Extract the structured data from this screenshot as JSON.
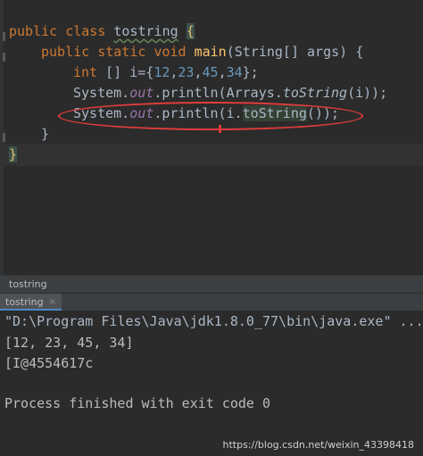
{
  "editor": {
    "lines": {
      "l1": {
        "kw1": "public",
        "kw2": "class",
        "classname": "tostring",
        "brace": "{"
      },
      "l2": {
        "kw1": "public",
        "kw2": "static",
        "kw3": "void",
        "method": "main",
        "params": "(String[] args) {"
      },
      "l3": {
        "kw": "int",
        "decl": " [] i={",
        "n1": "12",
        "n2": "23",
        "n3": "45",
        "n4": "34",
        "tail": "};"
      },
      "l4": {
        "pre": "System.",
        "field": "out",
        "mid": ".println(Arrays.",
        "method": "toString",
        "tail": "(i));"
      },
      "l5": {
        "pre": "System.",
        "field": "out",
        "mid": ".println(i.",
        "method": "toString",
        "tail": "());"
      },
      "l6": {
        "text": "}"
      },
      "l7": {
        "text": "}"
      }
    }
  },
  "breadcrumb": {
    "label": "tostring"
  },
  "run_panel": {
    "tab_label": "tostring",
    "tab_close": "×"
  },
  "console": {
    "lines": [
      "\"D:\\Program Files\\Java\\jdk1.8.0_77\\bin\\java.exe\" ...",
      "[12, 23, 45, 34]",
      "[I@4554617c",
      "",
      "Process finished with exit code 0"
    ]
  },
  "watermark": "https://blog.csdn.net/weixin_43398418"
}
